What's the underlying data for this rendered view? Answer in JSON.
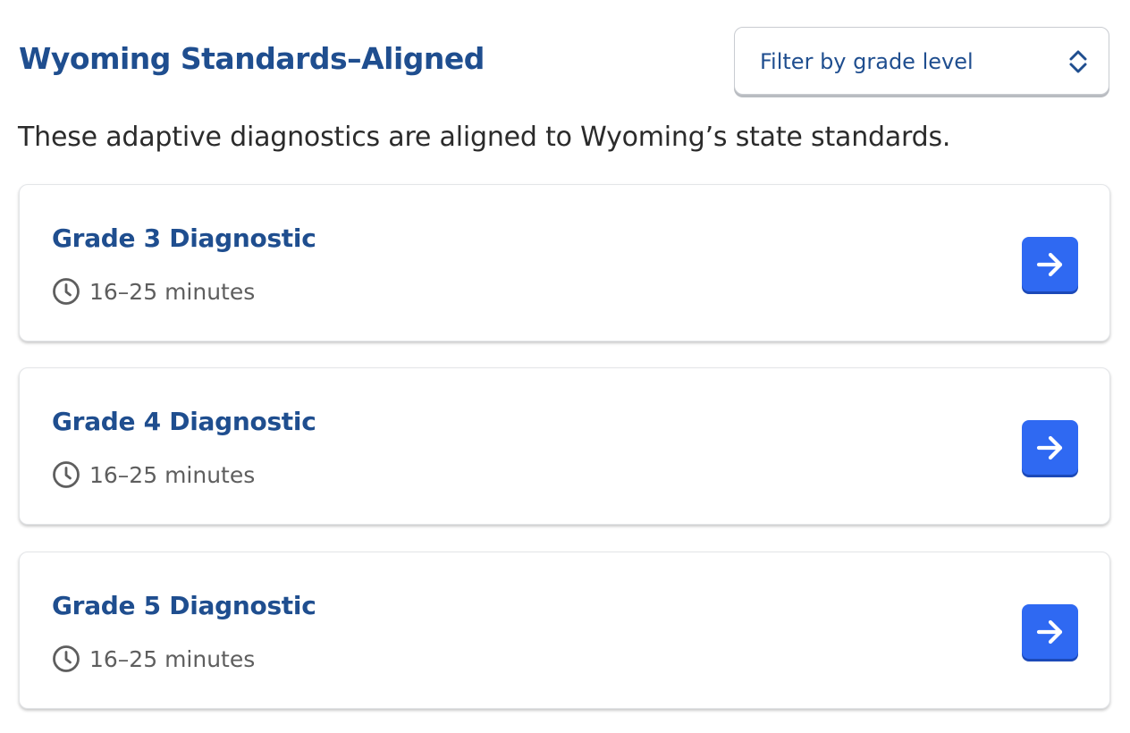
{
  "header": {
    "title": "Wyoming Standards–Aligned"
  },
  "filter": {
    "label": "Filter by grade level",
    "icon": "updown-chevron-icon"
  },
  "intro": {
    "text": "These adaptive diagnostics are aligned to Wyoming’s state standards."
  },
  "cards": [
    {
      "title": "Grade 3 Diagnostic",
      "duration": "16–25 minutes",
      "icon": "clock-icon",
      "action_icon": "arrow-right-icon"
    },
    {
      "title": "Grade 4 Diagnostic",
      "duration": "16–25 minutes",
      "icon": "clock-icon",
      "action_icon": "arrow-right-icon"
    },
    {
      "title": "Grade 5 Diagnostic",
      "duration": "16–25 minutes",
      "icon": "clock-icon",
      "action_icon": "arrow-right-icon"
    }
  ],
  "colors": {
    "heading": "#1f4e8f",
    "button": "#2f69f2",
    "body_text": "#2b2b2b",
    "meta_text": "#5e5e5e"
  }
}
